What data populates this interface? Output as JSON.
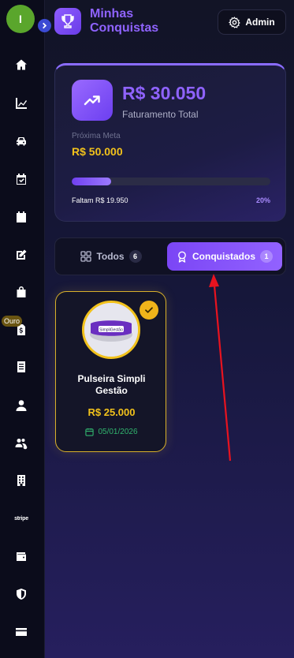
{
  "user": {
    "initial": "I"
  },
  "sidebar": {
    "badge": "Ouro",
    "items": [
      {
        "icon": "home-icon"
      },
      {
        "icon": "chart-line-icon"
      },
      {
        "icon": "car-icon"
      },
      {
        "icon": "calendar-check-icon"
      },
      {
        "icon": "calendar-icon"
      },
      {
        "icon": "edit-icon"
      },
      {
        "icon": "shopping-bag-icon"
      },
      {
        "icon": "file-dollar-icon"
      },
      {
        "icon": "document-icon"
      },
      {
        "icon": "user-icon"
      },
      {
        "icon": "users-cog-icon"
      },
      {
        "icon": "building-icon"
      },
      {
        "icon": "stripe-icon",
        "label": "stripe"
      },
      {
        "icon": "wallet-icon"
      },
      {
        "icon": "shield-icon"
      },
      {
        "icon": "credit-card-icon"
      }
    ]
  },
  "header": {
    "title": "Minhas Conquistas",
    "admin_label": "Admin"
  },
  "revenue": {
    "amount": "R$ 30.050",
    "label": "Faturamento Total",
    "goal_label": "Próxima Meta",
    "goal_value": "R$ 50.000",
    "remaining": "Faltam R$ 19.950",
    "percent_label": "20%",
    "progress_fraction": 0.2
  },
  "tabs": [
    {
      "label": "Todos",
      "count": "6",
      "active": false
    },
    {
      "label": "Conquistados",
      "count": "1",
      "active": true
    }
  ],
  "achievements": [
    {
      "name": "Pulseira Simpli Gestão",
      "value": "R$ 25.000",
      "date": "05/01/2026",
      "image_text": "SimpliGestão",
      "achieved": true
    }
  ],
  "colors": {
    "accent": "#8f63ff",
    "gold": "#f2c21b",
    "success": "#31b56e",
    "annotation": "#e8131f"
  }
}
